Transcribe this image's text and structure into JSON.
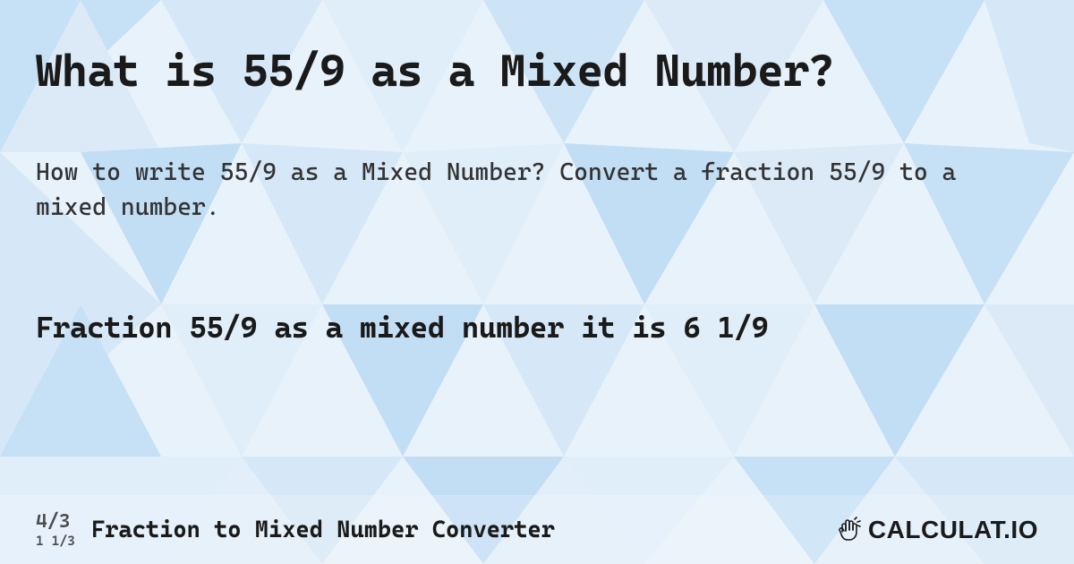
{
  "page": {
    "title": "What is 55/9 as a Mixed Number?",
    "description": "How to write 55/9 as a Mixed Number? Convert a fraction 55/9 to a mixed number.",
    "answer": "Fraction 55/9 as a mixed number it is 6 1/9"
  },
  "footer": {
    "icon_top": "4/3",
    "icon_bottom": "1 1/3",
    "converter_title": "Fraction to Mixed Number Converter",
    "brand": "CALCULAT.IO"
  },
  "colors": {
    "bg_base": "#e8f2fb",
    "tri_light": "#d6e8f7",
    "tri_mid": "#c2def4",
    "tri_dark": "#b0d4f0",
    "text": "#1a1a1a"
  }
}
